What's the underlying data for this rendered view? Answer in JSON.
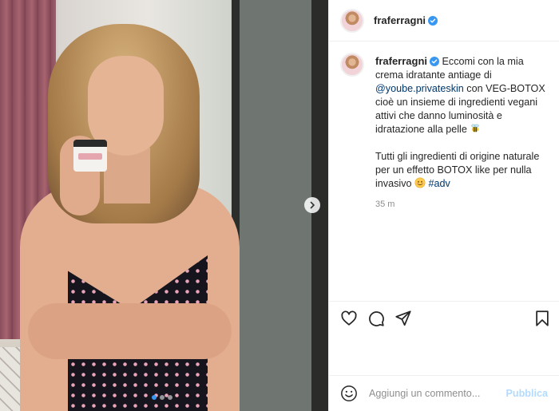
{
  "post": {
    "username": "fraferragni",
    "verified": true,
    "caption": {
      "text_1": "Eccomi con la mia crema idratante antiage di ",
      "mention": "@yoube.privateskin",
      "text_2": " con VEG-BOTOX cioè un insieme di ingredienti vegani attivi che danno luminosità e idratazione alla pelle ",
      "emoji_1": "bee-emoji",
      "text_3": "Tutti gli ingredienti di origine naturale per un effetto BOTOX like per nulla invasivo ",
      "emoji_2": "smiling-face-emoji",
      "hashtag": "#adv"
    },
    "timestamp": "35 m"
  },
  "media": {
    "image_count": 3,
    "current_index": 1
  },
  "comment": {
    "placeholder": "Aggiungi un commento...",
    "value": "",
    "publish_label": "Pubblica"
  },
  "colors": {
    "accent_blue": "#0095f6",
    "link": "#00376b",
    "publish_disabled": "#b3dbff",
    "muted": "#8e8e8e",
    "verified": "#3897f0"
  },
  "icons": {
    "verified": "verified-badge-icon",
    "like": "heart-icon",
    "comment": "comment-bubble-icon",
    "share": "paper-plane-icon",
    "save": "bookmark-icon",
    "emoji": "smiley-icon",
    "next": "chevron-right-icon"
  }
}
